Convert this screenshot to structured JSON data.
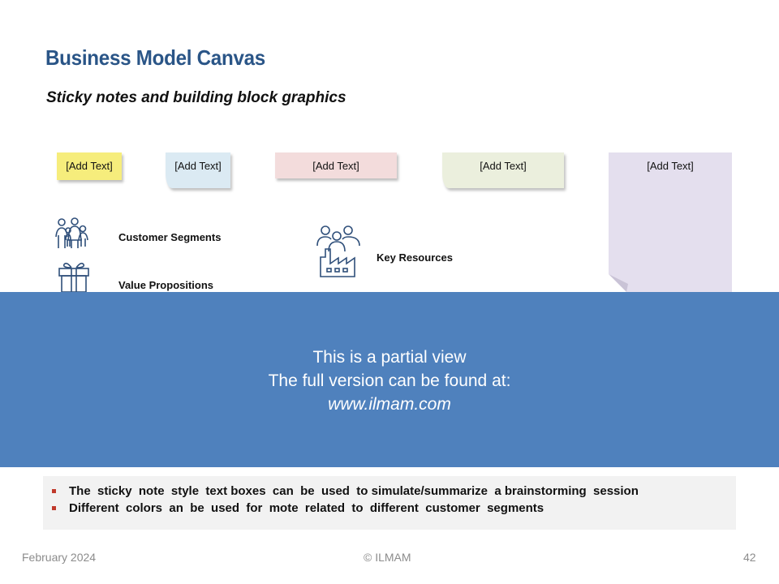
{
  "title": "Business Model Canvas",
  "subtitle": "Sticky notes and building block graphics",
  "notes": [
    "[Add Text]",
    "[Add Text]",
    "[Add Text]",
    "[Add Text]",
    "[Add Text]"
  ],
  "labels": {
    "customer_segments": "Customer  Segments",
    "value_propositions": "Value Propositions",
    "key_resources": "Key Resources"
  },
  "banner": {
    "line1": "This is a partial view",
    "line2": "The full version can be found at:",
    "url": "www.ilmam.com"
  },
  "bullets": [
    "The  sticky  note  style  text boxes  can  be  used  to simulate/summarize  a brainstorming  session",
    "Different  colors  an  be  used  for  mote  related  to  different  customer  segments"
  ],
  "footer": {
    "date": "February 2024",
    "copyright": "© ILMAM",
    "page": "42"
  },
  "icons": [
    "family-icon",
    "gift-icon",
    "factory-people-icon"
  ],
  "colors": {
    "title": "#2a5587",
    "banner": "#4f81bd",
    "bullet": "#c0392b",
    "note_yellow": "#f6ed7c",
    "note_blue": "#dbeaf3",
    "note_pink": "#f3dcdc",
    "note_green": "#ebefdd",
    "note_lavender": "#e4dfee"
  }
}
